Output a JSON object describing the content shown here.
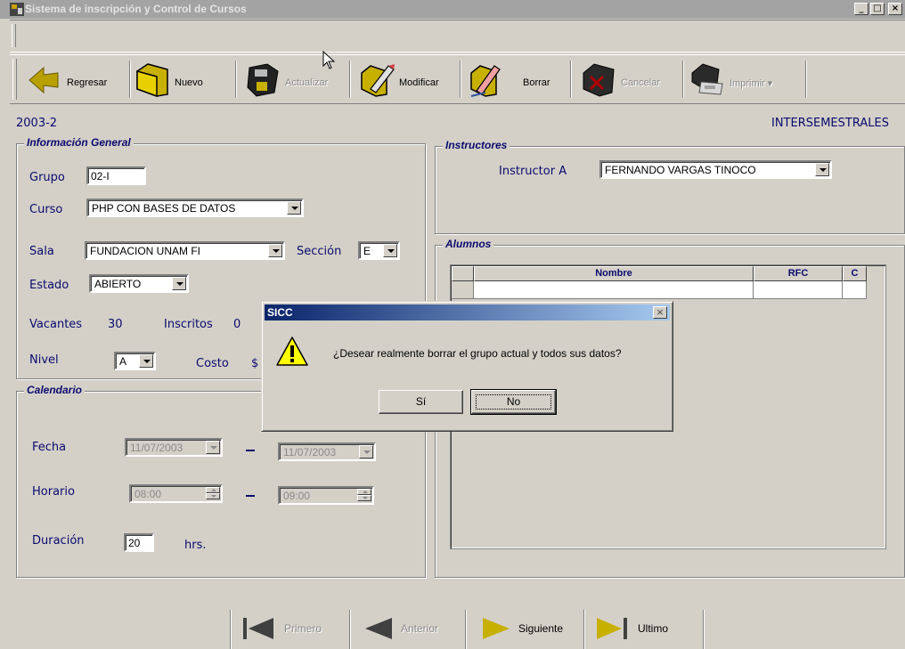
{
  "window": {
    "title": "Sistema de inscripción y Control de Cursos",
    "controls": [
      "_",
      "□",
      "×"
    ]
  },
  "toolbar": {
    "items": [
      {
        "label": "Regresar",
        "icon": "back-arrow-icon",
        "enabled": true
      },
      {
        "label": "Nuevo",
        "icon": "new-folder-icon",
        "enabled": true
      },
      {
        "label": "Actualizar",
        "icon": "save-disk-icon",
        "enabled": false
      },
      {
        "label": "Modificar",
        "icon": "edit-pencil-icon",
        "enabled": true
      },
      {
        "label": "Borrar",
        "icon": "delete-eraser-icon",
        "enabled": true
      },
      {
        "label": "Cancelar",
        "icon": "cancel-icon",
        "enabled": false
      },
      {
        "label": "Imprimir ▾",
        "icon": "printer-icon",
        "enabled": false
      }
    ]
  },
  "header": {
    "period": "2003-2",
    "period_type": "INTERSEMESTRALES"
  },
  "info": {
    "title": "Información General",
    "grupo_label": "Grupo",
    "grupo_value": "02-I",
    "curso_label": "Curso",
    "curso_value": "PHP CON BASES DE DATOS",
    "sala_label": "Sala",
    "sala_value": "FUNDACION UNAM FI",
    "seccion_label": "Sección",
    "seccion_value": "E",
    "estado_label": "Estado",
    "estado_value": "ABIERTO",
    "vacantes_label": "Vacantes",
    "vacantes_value": "30",
    "inscritos_label": "Inscritos",
    "inscritos_value": "0",
    "nivel_label": "Nivel",
    "nivel_value": "A",
    "costo_label": "Costo",
    "costo_value": "$"
  },
  "calendar": {
    "title": "Calendario",
    "fecha_label": "Fecha",
    "fecha_from": "11/07/2003",
    "fecha_to": "11/07/2003",
    "horario_label": "Horario",
    "hora_from": "08:00",
    "hora_to": "09:00",
    "duracion_label": "Duración",
    "duracion_value": "20",
    "duracion_unit": "hrs."
  },
  "instructors": {
    "title": "Instructores",
    "a_label": "Instructor A",
    "a_value": "FERNANDO VARGAS TINOCO"
  },
  "students": {
    "title": "Alumnos",
    "columns": [
      "",
      "Nombre",
      "RFC",
      "C"
    ]
  },
  "nav": {
    "items": [
      {
        "label": "Primero",
        "enabled": false
      },
      {
        "label": "Anterior",
        "enabled": false
      },
      {
        "label": "Siguiente",
        "enabled": true
      },
      {
        "label": "Ultimo",
        "enabled": true
      }
    ]
  },
  "dialog": {
    "title": "SICC",
    "close": "×",
    "message": "¿Desear realmente borrar el grupo actual y todos sus datos?",
    "yes": "Sí",
    "no": "No"
  },
  "colors": {
    "label_text": "#0a0a6e",
    "face": "#d4d0c8",
    "dialog_title_start": "#0a246a"
  }
}
